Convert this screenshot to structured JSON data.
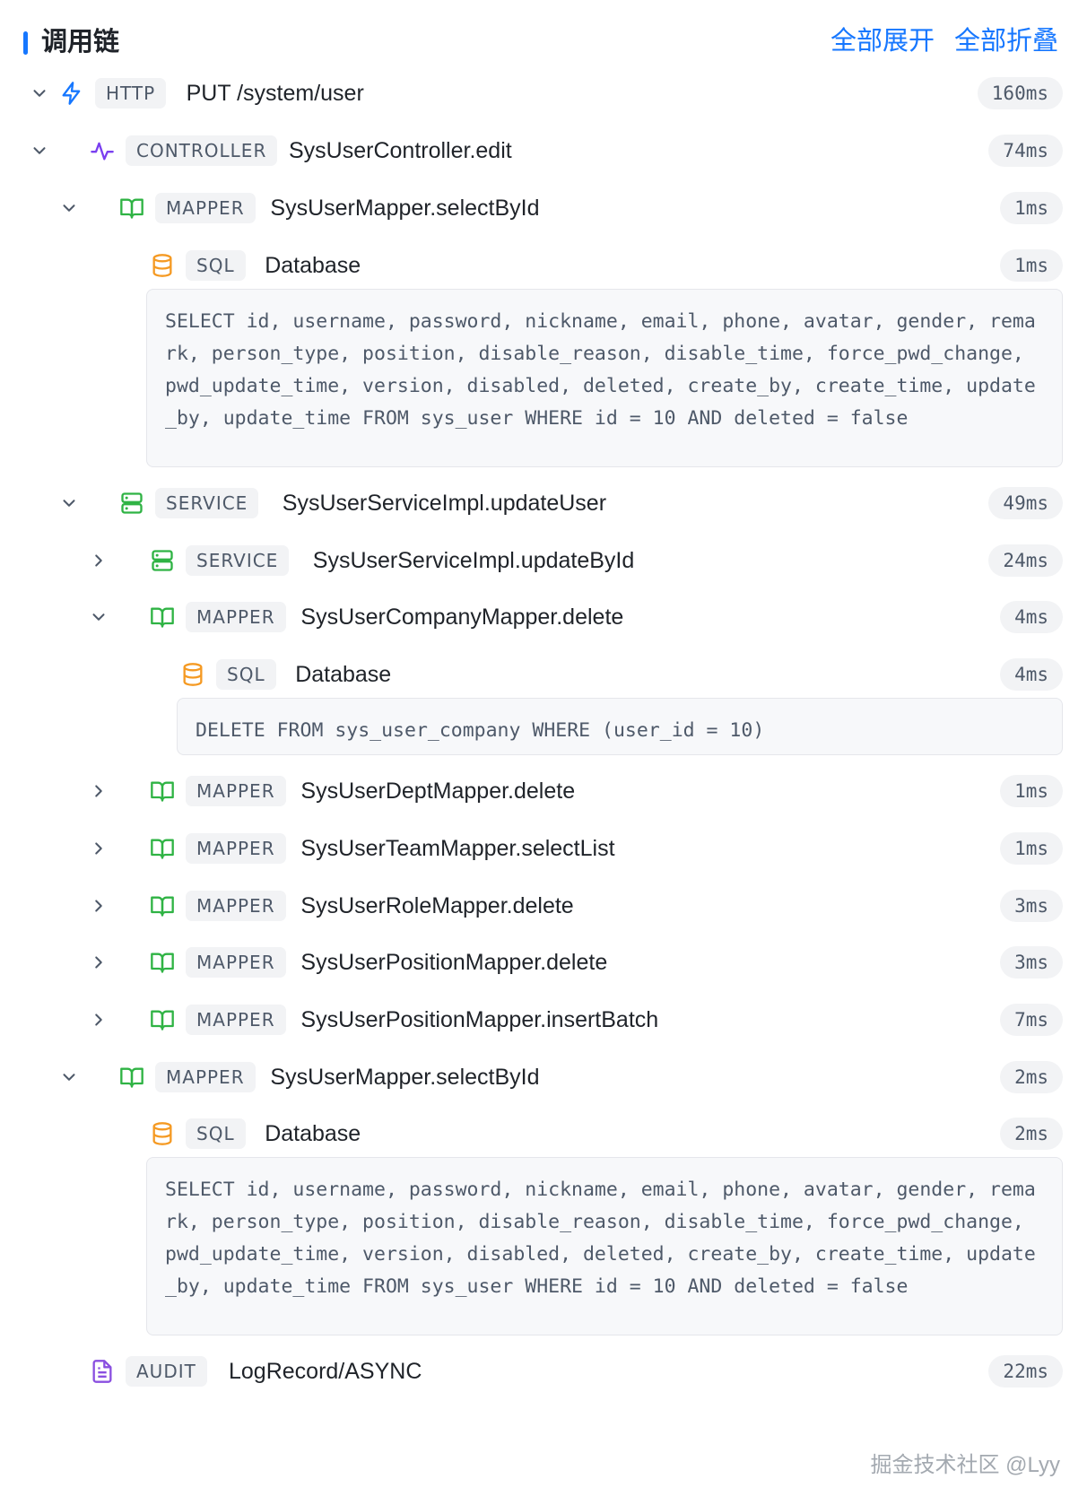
{
  "header": {
    "title": "调用链",
    "expand_all": "全部展开",
    "collapse_all": "全部折叠"
  },
  "trace": [
    {
      "depth": 0,
      "chevron": "down",
      "icon": "lightning-icon",
      "tag": "HTTP",
      "name": "PUT /system/user",
      "duration": "160ms"
    },
    {
      "depth": 1,
      "chevron": "down",
      "icon": "activity-icon",
      "tag": "CONTROLLER",
      "name": "SysUserController.edit",
      "duration": "74ms"
    },
    {
      "depth": 2,
      "chevron": "down",
      "icon": "book-open-icon",
      "tag": "MAPPER",
      "name": "SysUserMapper.selectById",
      "duration": "1ms"
    },
    {
      "depth": 3,
      "chevron": "none",
      "icon": "database-icon",
      "tag": "SQL",
      "name": "Database",
      "duration": "1ms",
      "sql": "SELECT id, username, password, nickname, email, phone, avatar, gender, remark, person_type, position, disable_reason, disable_time, force_pwd_change, pwd_update_time, version, disabled, deleted, create_by, create_time, update_by, update_time FROM sys_user WHERE id = 10 AND deleted = false"
    },
    {
      "depth": 2,
      "chevron": "down",
      "icon": "server-icon",
      "tag": "SERVICE",
      "name": "SysUserServiceImpl.updateUser",
      "duration": "49ms"
    },
    {
      "depth": 3,
      "chevron": "right",
      "icon": "server-icon",
      "tag": "SERVICE",
      "name": "SysUserServiceImpl.updateById",
      "duration": "24ms"
    },
    {
      "depth": 3,
      "chevron": "down",
      "icon": "book-open-icon",
      "tag": "MAPPER",
      "name": "SysUserCompanyMapper.delete",
      "duration": "4ms"
    },
    {
      "depth": 4,
      "chevron": "none",
      "icon": "database-icon",
      "tag": "SQL",
      "name": "Database",
      "duration": "4ms",
      "sql": "DELETE FROM sys_user_company WHERE (user_id = 10)"
    },
    {
      "depth": 3,
      "chevron": "right",
      "icon": "book-open-icon",
      "tag": "MAPPER",
      "name": "SysUserDeptMapper.delete",
      "duration": "1ms"
    },
    {
      "depth": 3,
      "chevron": "right",
      "icon": "book-open-icon",
      "tag": "MAPPER",
      "name": "SysUserTeamMapper.selectList",
      "duration": "1ms"
    },
    {
      "depth": 3,
      "chevron": "right",
      "icon": "book-open-icon",
      "tag": "MAPPER",
      "name": "SysUserRoleMapper.delete",
      "duration": "3ms"
    },
    {
      "depth": 3,
      "chevron": "right",
      "icon": "book-open-icon",
      "tag": "MAPPER",
      "name": "SysUserPositionMapper.delete",
      "duration": "3ms"
    },
    {
      "depth": 3,
      "chevron": "right",
      "icon": "book-open-icon",
      "tag": "MAPPER",
      "name": "SysUserPositionMapper.insertBatch",
      "duration": "7ms"
    },
    {
      "depth": 2,
      "chevron": "down",
      "icon": "book-open-icon",
      "tag": "MAPPER",
      "name": "SysUserMapper.selectById",
      "duration": "2ms"
    },
    {
      "depth": 3,
      "chevron": "none",
      "icon": "database-icon",
      "tag": "SQL",
      "name": "Database",
      "duration": "2ms",
      "sql": "SELECT id, username, password, nickname, email, phone, avatar, gender, remark, person_type, position, disable_reason, disable_time, force_pwd_change, pwd_update_time, version, disabled, deleted, create_by, create_time, update_by, update_time FROM sys_user WHERE id = 10 AND deleted = false"
    },
    {
      "depth": 1,
      "chevron": "none",
      "icon": "document-icon",
      "tag": "AUDIT",
      "name": "LogRecord/ASYNC",
      "duration": "22ms"
    }
  ],
  "watermark": "掘金技术社区 @Lyy",
  "colors": {
    "accent": "#1677ff",
    "lightning-icon": "#1677ff",
    "activity-icon": "#7a3ff0",
    "book-open-icon": "#2fb344",
    "server-icon": "#2fb344",
    "database-icon": "#f59a23",
    "document-icon": "#8a4fe0"
  }
}
